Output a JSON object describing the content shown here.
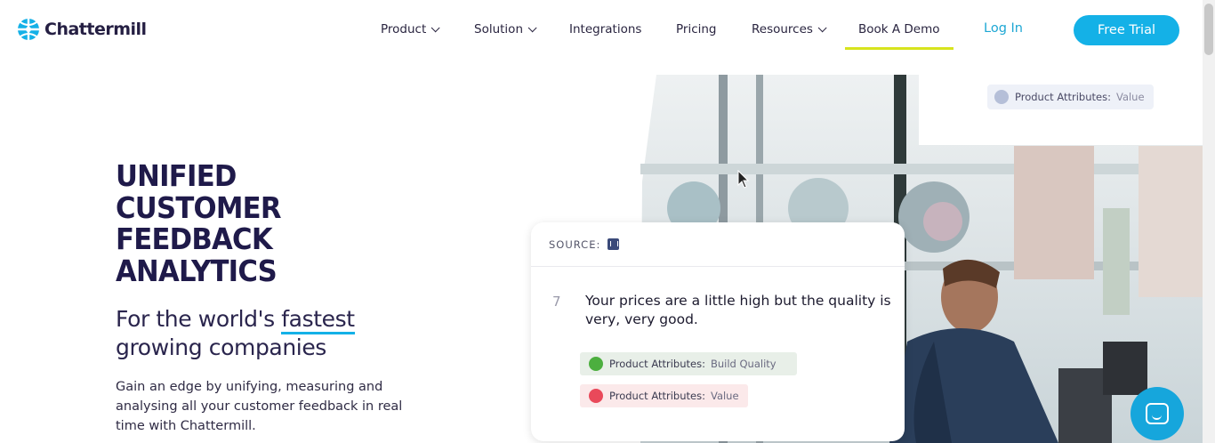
{
  "brand": {
    "name": "Chattermill",
    "logo_icon": "chattermill-globe-logo",
    "accent": "#14b1e7"
  },
  "nav": {
    "items": [
      {
        "label": "Product",
        "has_dropdown": true
      },
      {
        "label": "Solution",
        "has_dropdown": true
      },
      {
        "label": "Integrations",
        "has_dropdown": false
      },
      {
        "label": "Pricing",
        "has_dropdown": false
      },
      {
        "label": "Resources",
        "has_dropdown": true
      },
      {
        "label": "Book A Demo",
        "has_dropdown": false,
        "underline_color": "#d7e41d"
      }
    ],
    "login": "Log In",
    "cta": "Free Trial"
  },
  "hero": {
    "headline": [
      "UNIFIED",
      "CUSTOMER",
      "FEEDBACK",
      "ANALYTICS"
    ],
    "sub_before": "For the world's",
    "sub_highlight": "fastest",
    "sub_after": "growing companies",
    "body": "Gain an edge by unifying, measuring and analysing all your customer feedback in real time with Chattermill."
  },
  "visual": {
    "top_chip": {
      "label": "Product Attributes:",
      "value": "Value",
      "face_color": "#b5bfd8"
    },
    "card": {
      "source_label": "SOURCE:",
      "source_icon": "intercom-icon",
      "rating": "7",
      "quote": "Your prices are a little high but the quality is very, very good.",
      "chips": [
        {
          "label": "Product Attributes:",
          "value": "Build Quality",
          "sentiment": "positive",
          "face_color": "#4caf3f"
        },
        {
          "label": "Product Attributes:",
          "value": "Value",
          "sentiment": "negative",
          "face_color": "#e9495a"
        }
      ]
    }
  },
  "chat_widget": {
    "icon": "chat-bubble-icon",
    "color": "#16a6dc"
  }
}
